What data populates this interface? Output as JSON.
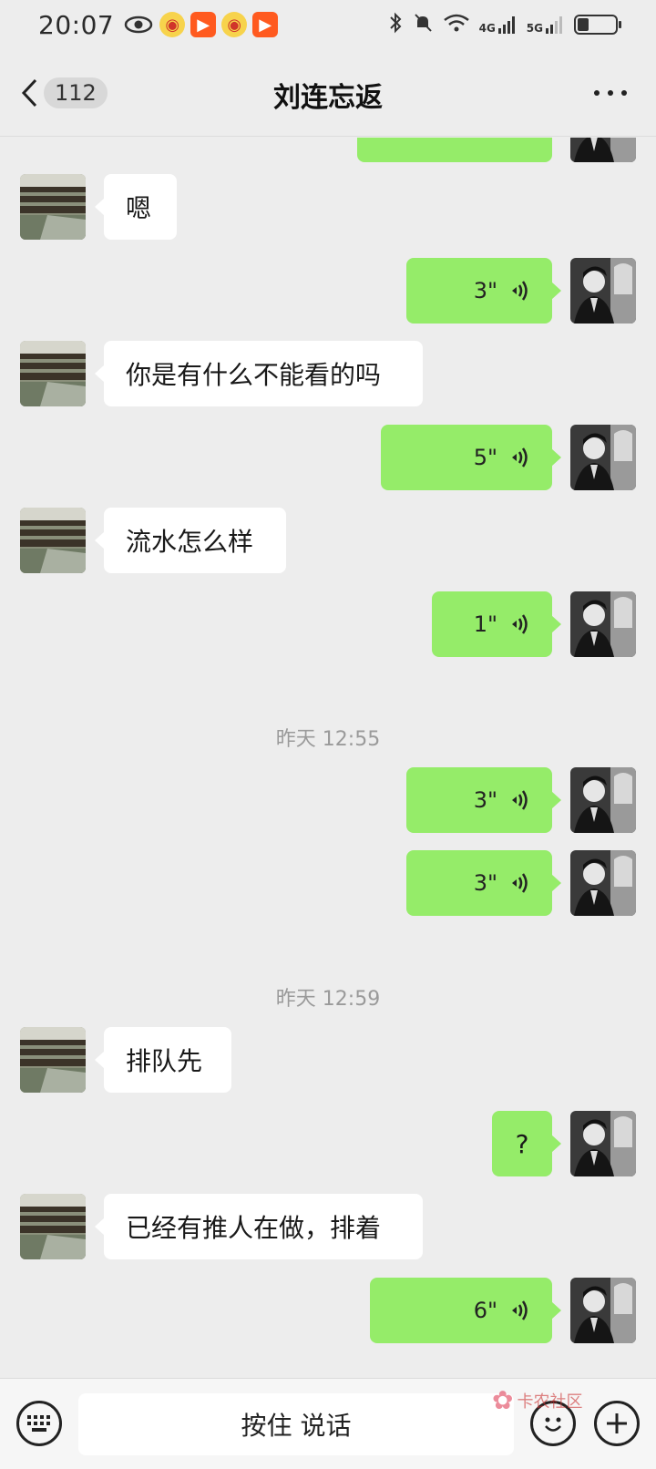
{
  "status_bar": {
    "time": "20:07",
    "network_1": "4G",
    "network_2": "5G",
    "battery_level": 0.3
  },
  "nav": {
    "unread_count": "112",
    "title": "刘连忘返"
  },
  "messages": [
    {
      "side": "right",
      "type": "text",
      "text": "",
      "partial": true
    },
    {
      "side": "left",
      "type": "text",
      "text": "嗯"
    },
    {
      "side": "right",
      "type": "voice",
      "duration": "3\""
    },
    {
      "side": "left",
      "type": "text",
      "text": "你是有什么不能看的吗"
    },
    {
      "side": "right",
      "type": "voice",
      "duration": "5\""
    },
    {
      "side": "left",
      "type": "text",
      "text": "流水怎么样"
    },
    {
      "side": "right",
      "type": "voice",
      "duration": "1\""
    },
    {
      "type": "timestamp",
      "text": "昨天 12:55"
    },
    {
      "side": "right",
      "type": "voice",
      "duration": "3\""
    },
    {
      "side": "right",
      "type": "voice",
      "duration": "3\""
    },
    {
      "type": "timestamp",
      "text": "昨天 12:59"
    },
    {
      "side": "left",
      "type": "text",
      "text": "排队先"
    },
    {
      "side": "right",
      "type": "text",
      "text": "?"
    },
    {
      "side": "left",
      "type": "text",
      "text": "已经有推人在做，排着"
    },
    {
      "side": "right",
      "type": "voice",
      "duration": "6\""
    }
  ],
  "input_bar": {
    "hold_to_talk": "按住 说话"
  },
  "watermark": {
    "text": "卡农社区"
  },
  "colors": {
    "background": "#ededed",
    "self_bubble": "#95ec69",
    "other_bubble": "#ffffff"
  },
  "icons": [
    "eye-icon",
    "weibo-icon",
    "kuaishou-icon",
    "bluetooth-icon",
    "mute-icon",
    "wifi-icon",
    "signal-icon",
    "battery-icon",
    "back-chevron-icon",
    "more-icon",
    "voice-wave-icon",
    "keyboard-icon",
    "emoji-icon",
    "plus-icon"
  ]
}
